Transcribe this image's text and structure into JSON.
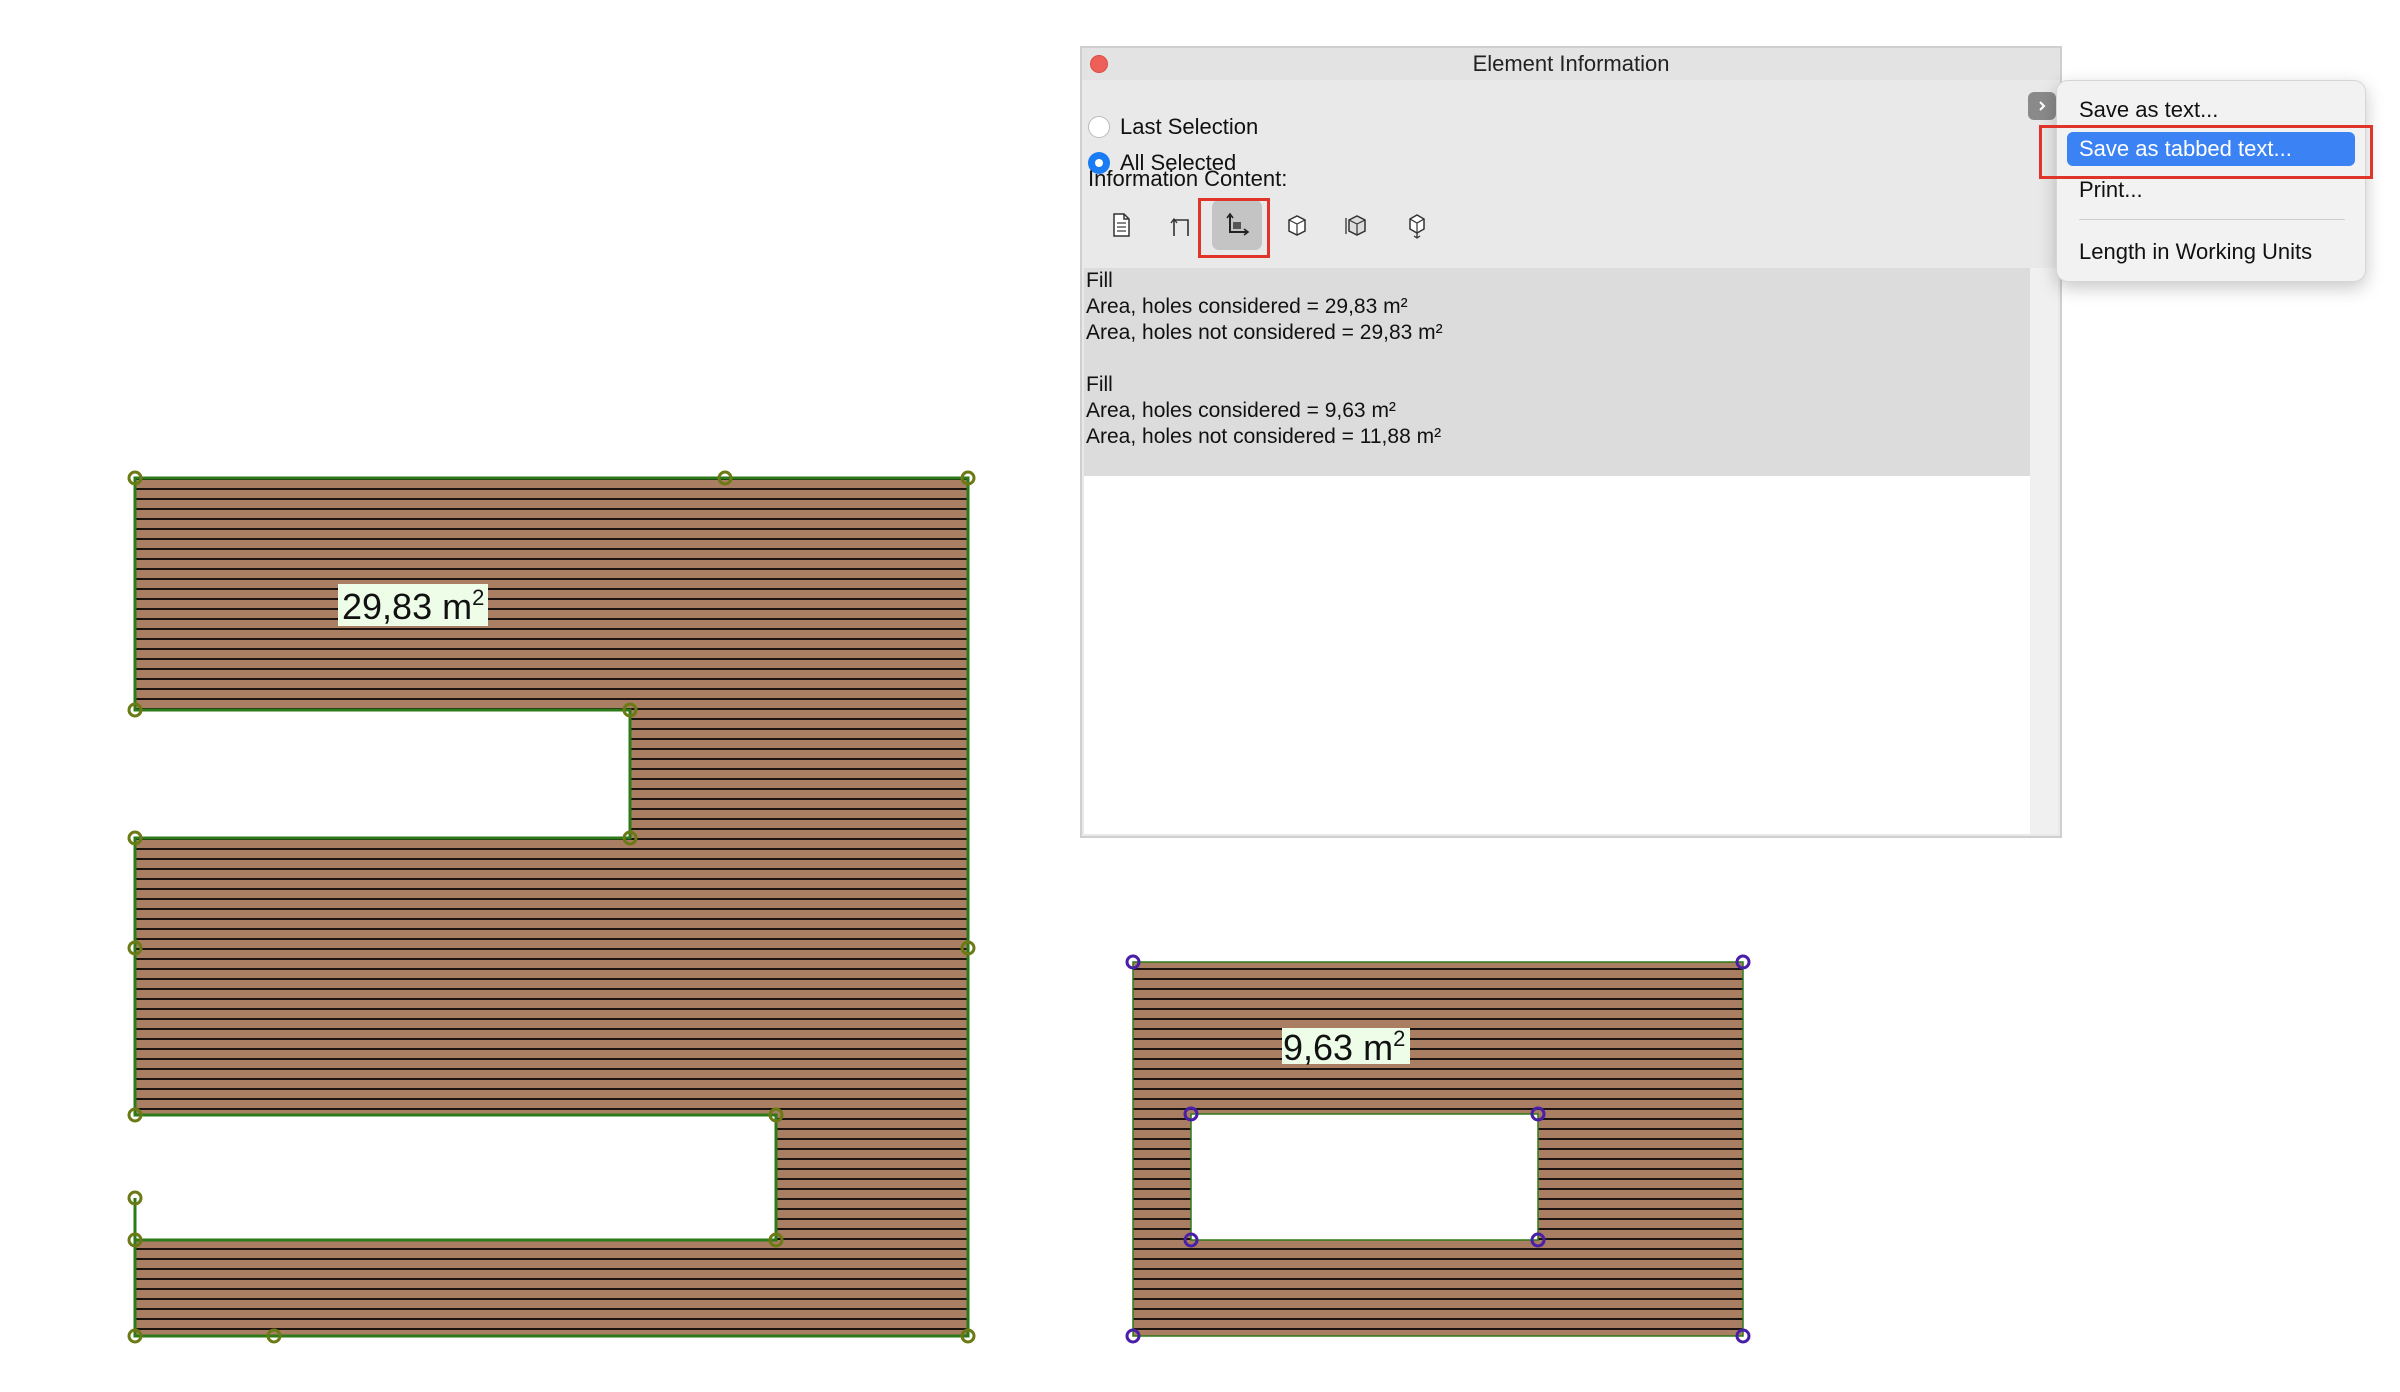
{
  "window": {
    "title": "Element Information"
  },
  "selection_mode": {
    "options": [
      {
        "label": "Last Selection",
        "checked": false
      },
      {
        "label": "All Selected",
        "checked": true
      }
    ]
  },
  "info_content": {
    "label": "Information Content:",
    "tools": [
      {
        "icon": "document-icon",
        "active": false
      },
      {
        "icon": "length-icon",
        "active": false
      },
      {
        "icon": "area-icon",
        "active": true
      },
      {
        "icon": "surface-icon",
        "active": false
      },
      {
        "icon": "volume-icon",
        "active": false
      },
      {
        "icon": "weight-icon",
        "active": false
      }
    ]
  },
  "results": [
    {
      "type": "Fill",
      "holes_considered": "Area, holes considered = 29,83 m²",
      "holes_not_considered": "Area, holes not considered = 29,83 m²"
    },
    {
      "type": "Fill",
      "holes_considered": "Area, holes considered = 9,63 m²",
      "holes_not_considered": "Area, holes not considered = 11,88 m²"
    }
  ],
  "menu": {
    "items": [
      "Save as text...",
      "Save as tabbed text...",
      "Print...",
      "Length in Working Units"
    ],
    "selected_index": 1
  },
  "canvas": {
    "fill1_label": {
      "value": "29,83 m",
      "sup": "2"
    },
    "fill2_label": {
      "value": "9,63 m",
      "sup": "2"
    }
  },
  "colors": {
    "fill_base": "#a97e63",
    "fill_stripe": "#1b1410",
    "fill1_outline": "#2c7a19",
    "fill1_nodes": "#6b7a14",
    "fill2_nodes": "#4a1fa8",
    "label_bg": "#eefde8",
    "highlight": "#e0342a",
    "menu_selected": "#3b83f5"
  }
}
